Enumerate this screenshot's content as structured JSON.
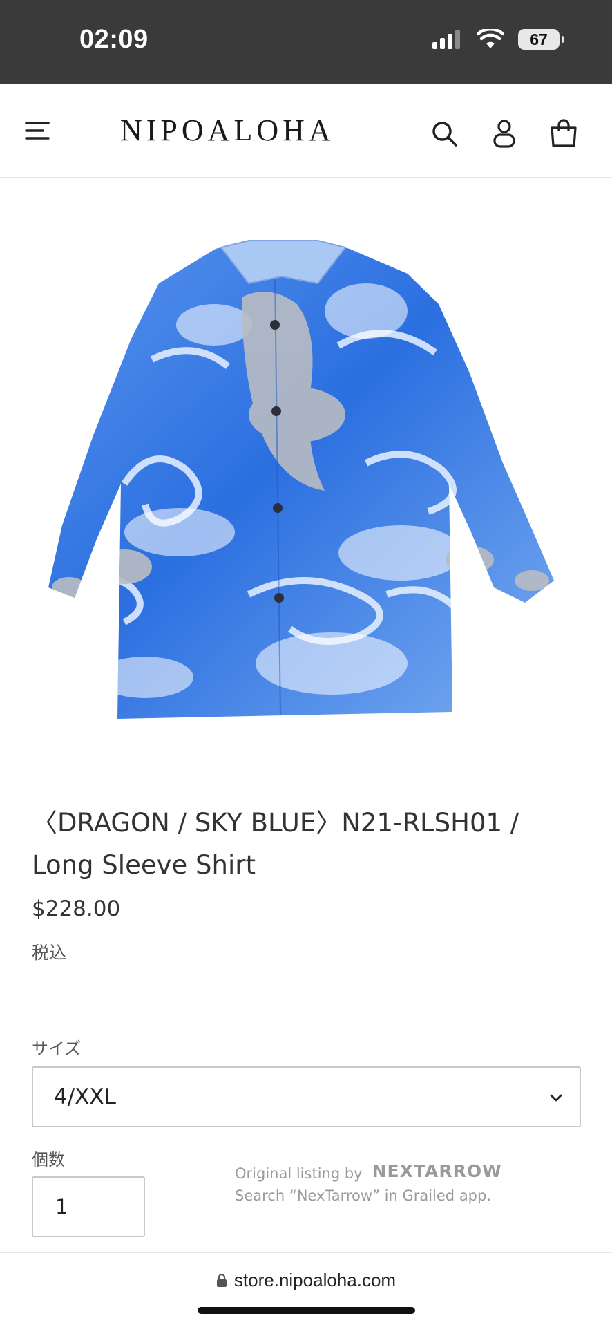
{
  "status_bar": {
    "time": "02:09",
    "battery": "67",
    "icons": [
      "signal-icon",
      "wifi-icon",
      "battery-icon"
    ]
  },
  "header": {
    "logo": "NIPOALOHA",
    "icons": [
      "menu-icon",
      "search-icon",
      "account-icon",
      "cart-icon"
    ]
  },
  "product": {
    "title": "〈DRAGON / SKY BLUE〉N21-RLSH01 / Long Sleeve Shirt",
    "price": "$228.00",
    "tax_note": "税込",
    "size_label": "サイズ",
    "size_value": "4/XXL",
    "quantity_label": "個数",
    "quantity_value": "1",
    "colors": {
      "primary_blue": "#2b6fe0",
      "light_blue": "#9cc2f5",
      "silver": "#b9bcc2"
    }
  },
  "watermark": {
    "line1": "Original listing by",
    "brand": "NEXTARROW",
    "line2": "Search “NexTarrow” in Grailed app."
  },
  "browser": {
    "url": "store.nipoaloha.com"
  }
}
